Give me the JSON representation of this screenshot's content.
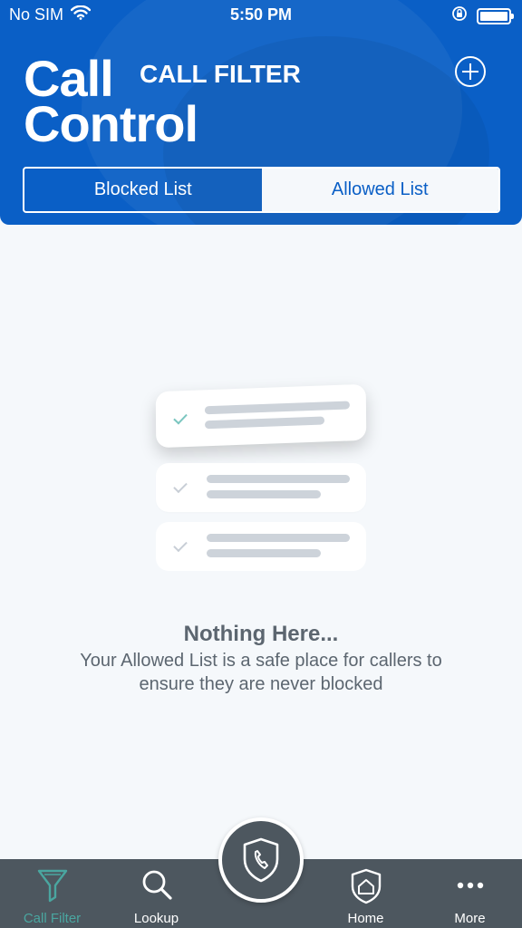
{
  "status_bar": {
    "carrier": "No SIM",
    "time": "5:50 PM"
  },
  "header": {
    "logo_line1": "Call",
    "logo_line2": "Control",
    "title": "CALL FILTER"
  },
  "segments": {
    "blocked": "Blocked List",
    "allowed": "Allowed List",
    "selected": "Allowed List"
  },
  "empty_state": {
    "title": "Nothing Here...",
    "description": "Your Allowed List is a safe place for callers to ensure they are never blocked"
  },
  "tabbar": {
    "items": [
      {
        "label": "Call Filter",
        "icon": "filter-icon",
        "active": true
      },
      {
        "label": "Lookup",
        "icon": "search-icon",
        "active": false
      },
      {
        "label": "Home",
        "icon": "home-icon",
        "active": false
      },
      {
        "label": "More",
        "icon": "more-icon",
        "active": false
      }
    ],
    "center_icon": "shield-phone-icon"
  },
  "colors": {
    "header_blue": "#0a5fc6",
    "tabbar": "#4d575f",
    "active_tab": "#4aa6a0",
    "text_gray": "#5c6670"
  }
}
